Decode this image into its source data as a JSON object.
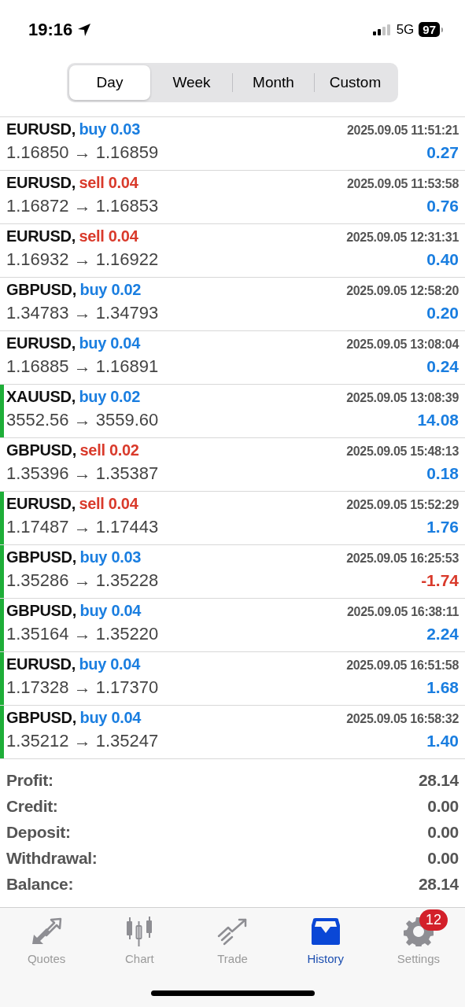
{
  "status_bar": {
    "time": "19:16",
    "network": "5G",
    "battery": "97"
  },
  "period_tabs": [
    {
      "label": "Day",
      "selected": true
    },
    {
      "label": "Week",
      "selected": false
    },
    {
      "label": "Month",
      "selected": false
    },
    {
      "label": "Custom",
      "selected": false
    }
  ],
  "deals": [
    {
      "symbol": "EURUSD,",
      "order": "buy 0.03",
      "kind": "buy",
      "time": "2025.09.05 11:51:21",
      "prices": "1.16850 → 1.16859",
      "profit": "0.27",
      "loss": false,
      "marked": false
    },
    {
      "symbol": "EURUSD,",
      "order": "sell 0.04",
      "kind": "sell",
      "time": "2025.09.05 11:53:58",
      "prices": "1.16872 → 1.16853",
      "profit": "0.76",
      "loss": false,
      "marked": false
    },
    {
      "symbol": "EURUSD,",
      "order": "sell 0.04",
      "kind": "sell",
      "time": "2025.09.05 12:31:31",
      "prices": "1.16932 → 1.16922",
      "profit": "0.40",
      "loss": false,
      "marked": false
    },
    {
      "symbol": "GBPUSD,",
      "order": "buy 0.02",
      "kind": "buy",
      "time": "2025.09.05 12:58:20",
      "prices": "1.34783 → 1.34793",
      "profit": "0.20",
      "loss": false,
      "marked": false
    },
    {
      "symbol": "EURUSD,",
      "order": "buy 0.04",
      "kind": "buy",
      "time": "2025.09.05 13:08:04",
      "prices": "1.16885 → 1.16891",
      "profit": "0.24",
      "loss": false,
      "marked": false
    },
    {
      "symbol": "XAUUSD,",
      "order": "buy 0.02",
      "kind": "buy",
      "time": "2025.09.05 13:08:39",
      "prices": "3552.56 → 3559.60",
      "profit": "14.08",
      "loss": false,
      "marked": true
    },
    {
      "symbol": "GBPUSD,",
      "order": "sell 0.02",
      "kind": "sell",
      "time": "2025.09.05 15:48:13",
      "prices": "1.35396 → 1.35387",
      "profit": "0.18",
      "loss": false,
      "marked": false
    },
    {
      "symbol": "EURUSD,",
      "order": "sell 0.04",
      "kind": "sell",
      "time": "2025.09.05 15:52:29",
      "prices": "1.17487 → 1.17443",
      "profit": "1.76",
      "loss": false,
      "marked": true
    },
    {
      "symbol": "GBPUSD,",
      "order": "buy 0.03",
      "kind": "buy",
      "time": "2025.09.05 16:25:53",
      "prices": "1.35286 → 1.35228",
      "profit": "-1.74",
      "loss": true,
      "marked": true
    },
    {
      "symbol": "GBPUSD,",
      "order": "buy 0.04",
      "kind": "buy",
      "time": "2025.09.05 16:38:11",
      "prices": "1.35164 → 1.35220",
      "profit": "2.24",
      "loss": false,
      "marked": true
    },
    {
      "symbol": "EURUSD,",
      "order": "buy 0.04",
      "kind": "buy",
      "time": "2025.09.05 16:51:58",
      "prices": "1.17328 → 1.17370",
      "profit": "1.68",
      "loss": false,
      "marked": true
    },
    {
      "symbol": "GBPUSD,",
      "order": "buy 0.04",
      "kind": "buy",
      "time": "2025.09.05 16:58:32",
      "prices": "1.35212 → 1.35247",
      "profit": "1.40",
      "loss": false,
      "marked": true
    }
  ],
  "summary": [
    {
      "label": "Profit:",
      "value": "28.14"
    },
    {
      "label": "Credit:",
      "value": "0.00"
    },
    {
      "label": "Deposit:",
      "value": "0.00"
    },
    {
      "label": "Withdrawal:",
      "value": "0.00"
    },
    {
      "label": "Balance:",
      "value": "28.14"
    }
  ],
  "tab_bar": [
    {
      "kind": "quotes",
      "label": "Quotes",
      "selected": false
    },
    {
      "kind": "chart",
      "label": "Chart",
      "selected": false
    },
    {
      "kind": "trade",
      "label": "Trade",
      "selected": false
    },
    {
      "kind": "history",
      "label": "History",
      "selected": true
    },
    {
      "kind": "settings",
      "label": "Settings",
      "selected": false,
      "badge": "12"
    }
  ]
}
